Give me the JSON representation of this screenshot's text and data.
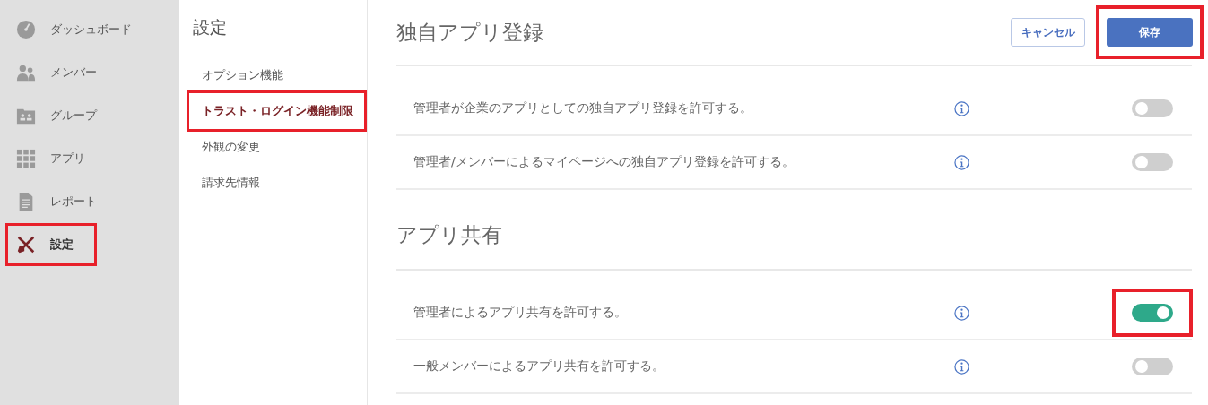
{
  "sidebar": {
    "items": [
      {
        "label": "ダッシュボード",
        "selected": false,
        "highlighted": false
      },
      {
        "label": "メンバー",
        "selected": false,
        "highlighted": false
      },
      {
        "label": "グループ",
        "selected": false,
        "highlighted": false
      },
      {
        "label": "アプリ",
        "selected": false,
        "highlighted": false
      },
      {
        "label": "レポート",
        "selected": false,
        "highlighted": false
      },
      {
        "label": "設定",
        "selected": true,
        "highlighted": true
      }
    ]
  },
  "submenu": {
    "title": "設定",
    "items": [
      {
        "label": "オプション機能",
        "selected": false,
        "highlighted": false
      },
      {
        "label": "トラスト・ログイン機能制限",
        "selected": true,
        "highlighted": true
      },
      {
        "label": "外観の変更",
        "selected": false,
        "highlighted": false
      },
      {
        "label": "請求先情報",
        "selected": false,
        "highlighted": false
      }
    ]
  },
  "cancel_button": {
    "label": "キャンセル"
  },
  "save_button": {
    "label": "保存",
    "highlighted": true
  },
  "sections": [
    {
      "title": "独自アプリ登録",
      "settings": [
        {
          "label": "管理者が企業のアプリとしての独自アプリ登録を許可する。",
          "on": false,
          "highlighted": false
        },
        {
          "label": "管理者/メンバーによるマイページへの独自アプリ登録を許可する。",
          "on": false,
          "highlighted": false
        }
      ]
    },
    {
      "title": "アプリ共有",
      "settings": [
        {
          "label": "管理者によるアプリ共有を許可する。",
          "on": true,
          "highlighted": true
        },
        {
          "label": "一般メンバーによるアプリ共有を許可する。",
          "on": false,
          "highlighted": false
        }
      ]
    }
  ]
}
